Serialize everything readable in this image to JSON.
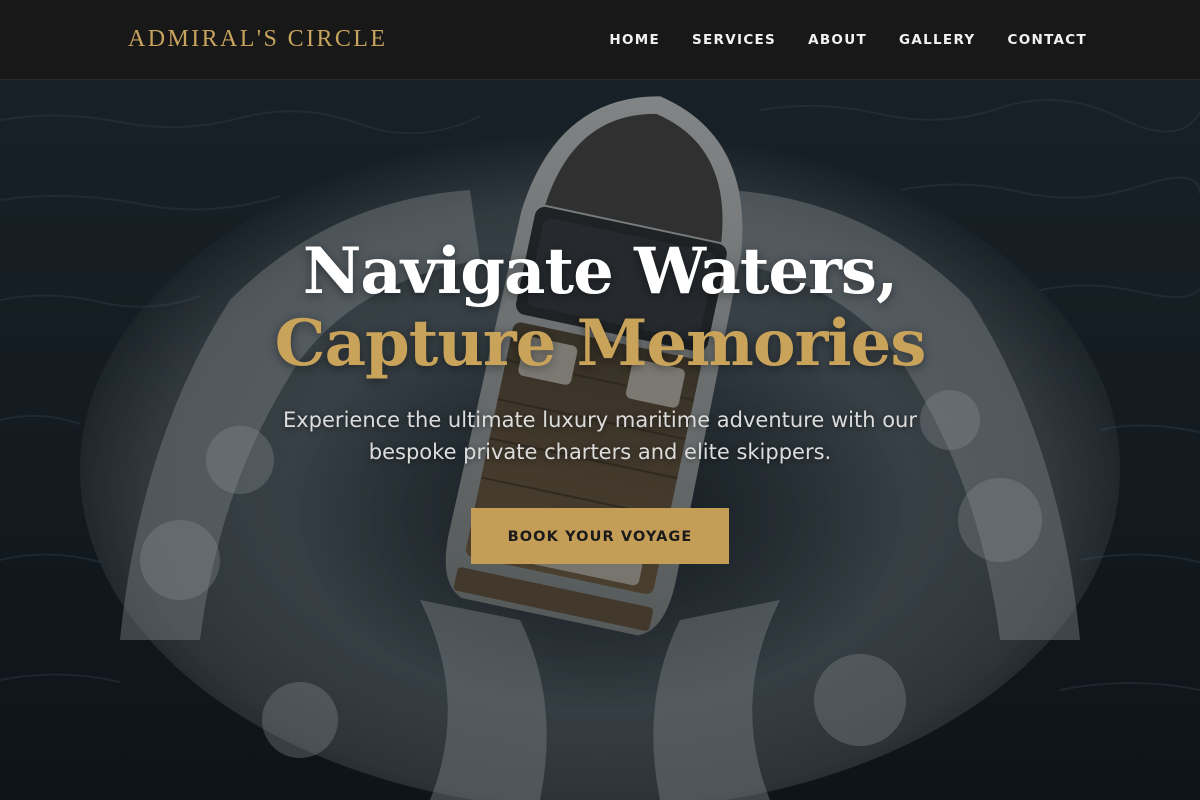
{
  "brand": {
    "name": "ADMIRAL'S CIRCLE"
  },
  "nav": {
    "items": [
      {
        "label": "HOME"
      },
      {
        "label": "SERVICES"
      },
      {
        "label": "ABOUT"
      },
      {
        "label": "GALLERY"
      },
      {
        "label": "CONTACT"
      }
    ]
  },
  "hero": {
    "title_line1": "Navigate Waters,",
    "title_line2": "Capture Memories",
    "subtitle": "Experience the ultimate luxury maritime adventure with our bespoke private charters and elite skippers.",
    "cta_label": "BOOK YOUR VOYAGE"
  },
  "colors": {
    "accent": "#c9a35a",
    "nav_background": "#181818",
    "cta_background": "#c49e57",
    "cta_text": "#1a1a1a"
  }
}
